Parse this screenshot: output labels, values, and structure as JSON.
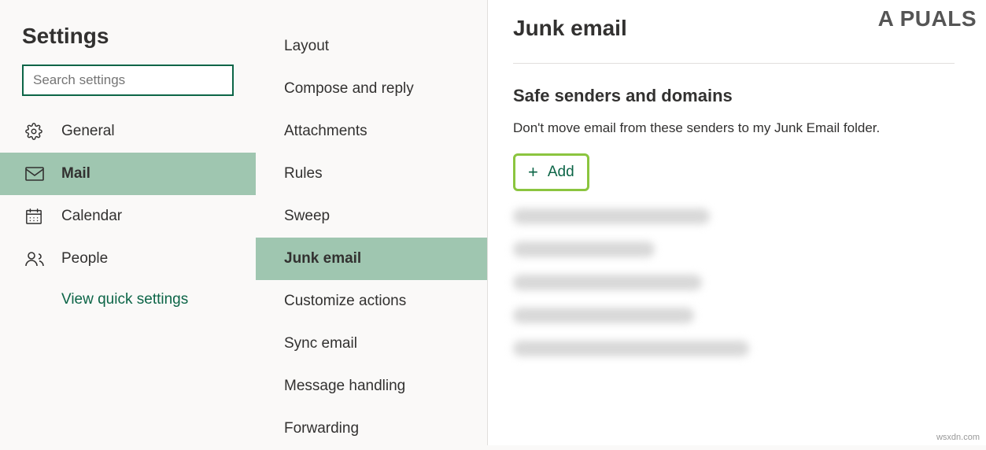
{
  "header": {
    "title": "Settings"
  },
  "search": {
    "placeholder": "Search settings"
  },
  "nav": {
    "items": [
      {
        "label": "General"
      },
      {
        "label": "Mail"
      },
      {
        "label": "Calendar"
      },
      {
        "label": "People"
      }
    ],
    "quick": "View quick settings"
  },
  "sub": {
    "items": [
      "Layout",
      "Compose and reply",
      "Attachments",
      "Rules",
      "Sweep",
      "Junk email",
      "Customize actions",
      "Sync email",
      "Message handling",
      "Forwarding"
    ]
  },
  "page": {
    "title": "Junk email",
    "section_title": "Safe senders and domains",
    "section_desc": "Don't move email from these senders to my Junk Email folder.",
    "add_label": "Add"
  },
  "logo": {
    "text": "A  PUALS"
  },
  "attribution": "wsxdn.com"
}
